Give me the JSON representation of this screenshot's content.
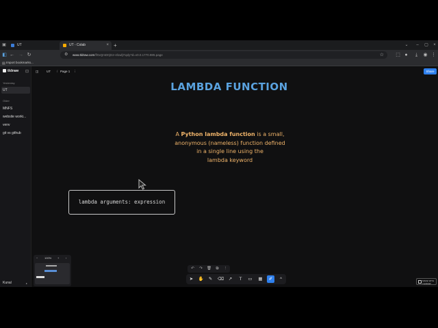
{
  "browser": {
    "tabs": [
      {
        "label": "UT",
        "active": false
      },
      {
        "label": "UT - Colab",
        "active": true
      }
    ],
    "url_host": "www.tldraw.com",
    "url_path": "/f/0xQmD0jG2-4l1wlj7oply?d=v0.0.1770.985.page",
    "bookmarks_label": "Import bookmarks..."
  },
  "tldraw": {
    "logo": "tldraw",
    "sidebar": {
      "sections": [
        {
          "heading": "Yesterday",
          "items": [
            {
              "label": "UT",
              "active": true
            }
          ]
        },
        {
          "heading": "Older",
          "items": [
            {
              "label": "MNFS",
              "active": false
            },
            {
              "label": "website worki...",
              "active": false
            },
            {
              "label": "venv",
              "active": false
            },
            {
              "label": "git vs github",
              "active": false
            }
          ]
        }
      ],
      "user": "Kunal"
    },
    "topbar": {
      "file": "UT",
      "page": "Page 1",
      "more": "⋮"
    },
    "share": "Share",
    "zoom": "100%",
    "made_with": [
      "MADE WITH",
      "TLDRAW"
    ]
  },
  "canvas": {
    "title": "LAMBDA FUNCTION",
    "desc_line1_pre": "A ",
    "desc_bold": "Python lambda function",
    "desc_line1_post": " is a small,",
    "desc_line2": "anonymous (nameless) function defined",
    "desc_line3": "in a single line using the",
    "desc_line4": "lambda keyword",
    "code": "lambda arguments: expression"
  },
  "colors": {
    "title": "#5aa2df",
    "description": "#f0b46a",
    "accent": "#2f80ed"
  },
  "icons": {
    "tools": [
      "select-icon",
      "hand-icon",
      "draw-icon",
      "eraser-icon",
      "arrow-icon",
      "text-icon",
      "note-icon",
      "image-icon",
      "pencil-icon",
      "more-tools-icon"
    ],
    "actions": [
      "undo-icon",
      "redo-icon",
      "delete-icon",
      "duplicate-icon",
      "more-icon"
    ]
  }
}
